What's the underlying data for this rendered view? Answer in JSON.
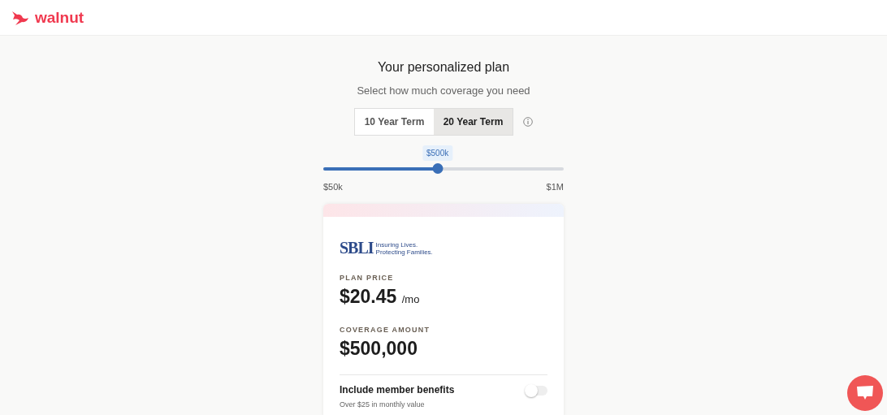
{
  "header": {
    "brand": "walnut"
  },
  "plan": {
    "title": "Your personalized plan",
    "subtitle": "Select how much coverage you need"
  },
  "terms": [
    {
      "label": "10 Year Term",
      "selected": false
    },
    {
      "label": "20 Year Term",
      "selected": true
    }
  ],
  "coverage_slider": {
    "level": 0.475,
    "tooltip": "$500k",
    "min_label": "$50k",
    "max_label": "$1M"
  },
  "card": {
    "insurer": {
      "name": "SBLI",
      "tagline": [
        "Insuring Lives.",
        "Protecting Families."
      ]
    },
    "price_label": "PLAN PRICE",
    "price": "$20.45",
    "price_unit": "/mo",
    "coverage_label": "COVERAGE AMOUNT",
    "coverage": "$500,000",
    "benefits": {
      "title": "Include member benefits",
      "subtitle": "Over $25 in monthly value",
      "on": false
    }
  }
}
